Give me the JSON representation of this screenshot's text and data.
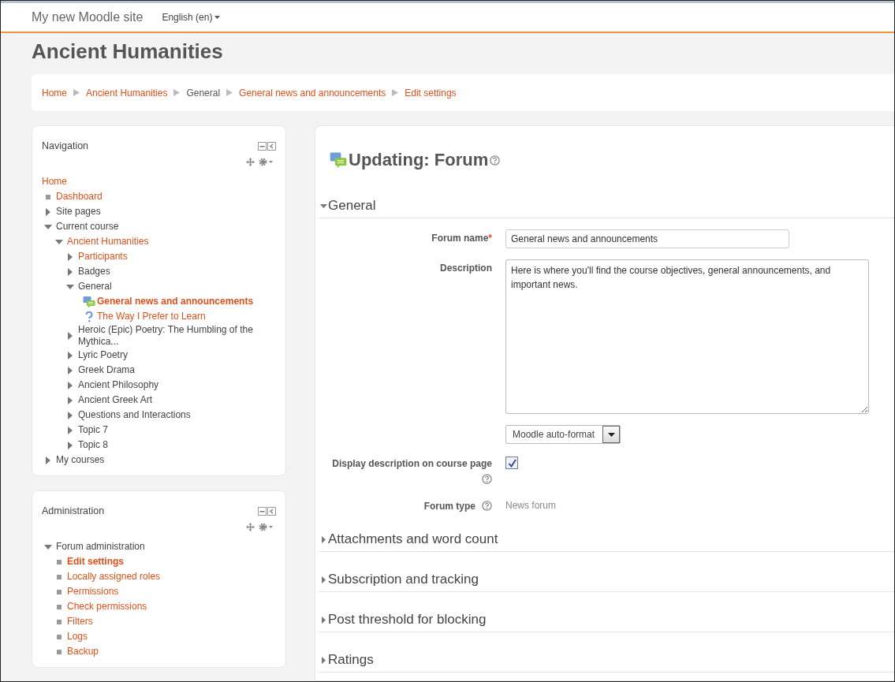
{
  "navbar": {
    "site_name": "My new Moodle site",
    "language": "English (en)"
  },
  "page_title": "Ancient Humanities",
  "breadcrumb": [
    {
      "label": "Home",
      "link": true
    },
    {
      "label": "Ancient Humanities",
      "link": true
    },
    {
      "label": "General",
      "link": false
    },
    {
      "label": "General news and announcements",
      "link": true
    },
    {
      "label": "Edit settings",
      "link": true
    }
  ],
  "blocks": [
    {
      "title": "Navigation",
      "tree": [
        {
          "label": "Home",
          "kind": "root",
          "link": true,
          "current": false
        },
        {
          "label": "Dashboard",
          "kind": "leaf",
          "link": true,
          "current": false
        },
        {
          "label": "Site pages",
          "kind": "branch",
          "expanded": false,
          "link": false,
          "current": false
        },
        {
          "label": "Current course",
          "kind": "branch",
          "expanded": true,
          "link": false,
          "current": false,
          "children": [
            {
              "label": "Ancient Humanities",
              "kind": "branch",
              "expanded": true,
              "link": true,
              "current": false,
              "children": [
                {
                  "label": "Participants",
                  "kind": "branch",
                  "expanded": false,
                  "link": true,
                  "current": false
                },
                {
                  "label": "Badges",
                  "kind": "branch",
                  "expanded": false,
                  "link": false,
                  "current": false
                },
                {
                  "label": "General",
                  "kind": "branch",
                  "expanded": true,
                  "link": false,
                  "current": false,
                  "children": [
                    {
                      "label": "General news and announcements",
                      "kind": "forum",
                      "link": true,
                      "current": true
                    },
                    {
                      "label": "The Way I Prefer to Learn",
                      "kind": "question",
                      "link": true,
                      "current": false
                    }
                  ]
                },
                {
                  "label": "Heroic (Epic) Poetry: The Humbling of the Mythica...",
                  "kind": "branch",
                  "expanded": false,
                  "link": false,
                  "current": false
                },
                {
                  "label": "Lyric Poetry",
                  "kind": "branch",
                  "expanded": false,
                  "link": false,
                  "current": false
                },
                {
                  "label": "Greek Drama",
                  "kind": "branch",
                  "expanded": false,
                  "link": false,
                  "current": false
                },
                {
                  "label": "Ancient Philosophy",
                  "kind": "branch",
                  "expanded": false,
                  "link": false,
                  "current": false
                },
                {
                  "label": "Ancient Greek Art",
                  "kind": "branch",
                  "expanded": false,
                  "link": false,
                  "current": false
                },
                {
                  "label": "Questions and Interactions",
                  "kind": "branch",
                  "expanded": false,
                  "link": false,
                  "current": false
                },
                {
                  "label": "Topic 7",
                  "kind": "branch",
                  "expanded": false,
                  "link": false,
                  "current": false
                },
                {
                  "label": "Topic 8",
                  "kind": "branch",
                  "expanded": false,
                  "link": false,
                  "current": false
                }
              ]
            }
          ]
        },
        {
          "label": "My courses",
          "kind": "branch",
          "expanded": false,
          "link": false,
          "current": false
        }
      ]
    },
    {
      "title": "Administration",
      "tree": [
        {
          "label": "Forum administration",
          "kind": "branch",
          "expanded": true,
          "link": false,
          "current": false,
          "children": [
            {
              "label": "Edit settings",
              "kind": "leaf",
              "link": true,
              "current": true
            },
            {
              "label": "Locally assigned roles",
              "kind": "leaf",
              "link": true,
              "current": false
            },
            {
              "label": "Permissions",
              "kind": "leaf",
              "link": true,
              "current": false
            },
            {
              "label": "Check permissions",
              "kind": "leaf",
              "link": true,
              "current": false
            },
            {
              "label": "Filters",
              "kind": "leaf",
              "link": true,
              "current": false
            },
            {
              "label": "Logs",
              "kind": "leaf",
              "link": true,
              "current": false
            },
            {
              "label": "Backup",
              "kind": "leaf",
              "link": true,
              "current": false
            }
          ]
        }
      ]
    }
  ],
  "form": {
    "heading": "Updating: Forum",
    "sections": [
      {
        "title": "General",
        "expanded": true,
        "fields": [
          {
            "kind": "text",
            "label": "Forum name",
            "required_mark": "*",
            "value": "General news and announcements"
          },
          {
            "kind": "textarea",
            "label": "Description",
            "value": "Here is where you'll find the course objectives, general announcements, and important news.",
            "format": "Moodle auto-format"
          },
          {
            "kind": "checkbox",
            "label": "Display description on course page",
            "checked": true
          },
          {
            "kind": "static",
            "label": "Forum type",
            "value": "News forum"
          }
        ]
      },
      {
        "title": "Attachments and word count",
        "expanded": false
      },
      {
        "title": "Subscription and tracking",
        "expanded": false
      },
      {
        "title": "Post threshold for blocking",
        "expanded": false
      },
      {
        "title": "Ratings",
        "expanded": false
      }
    ]
  }
}
